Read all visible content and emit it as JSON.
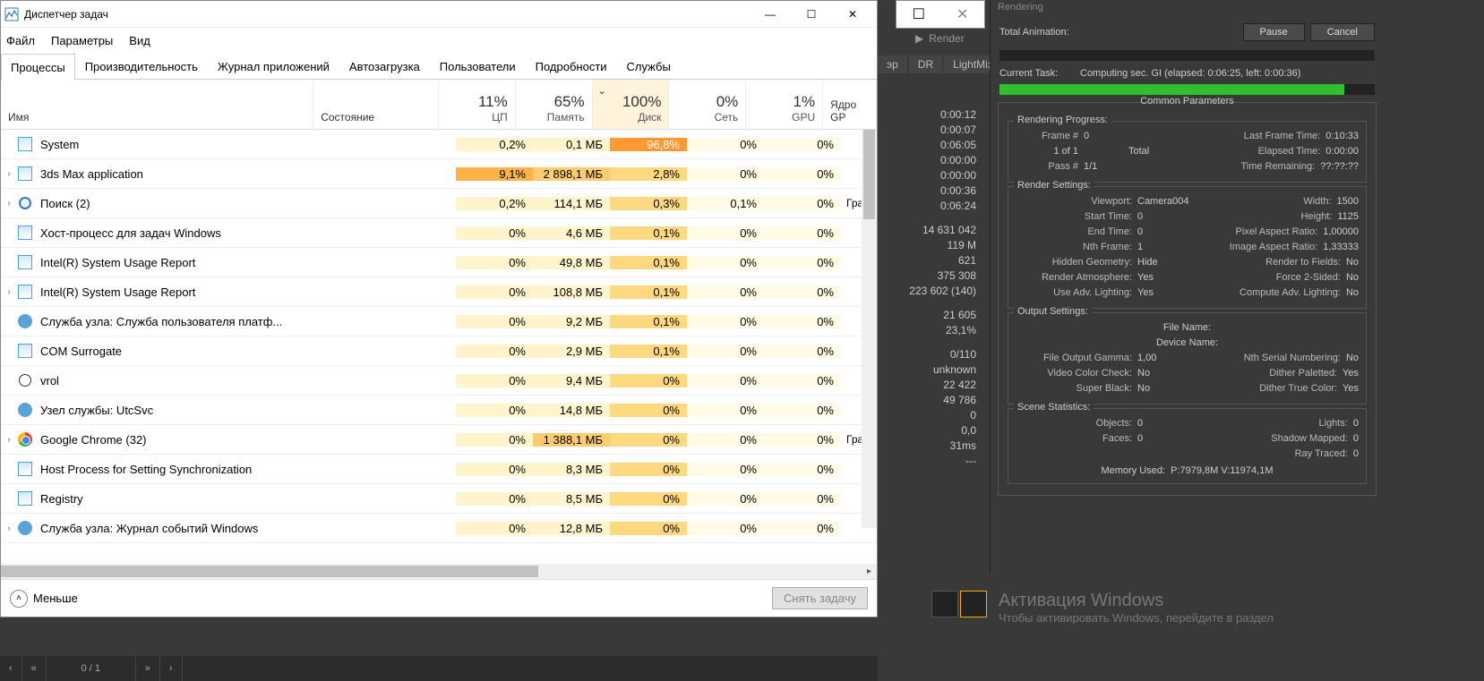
{
  "task_manager": {
    "title": "Диспетчер задач",
    "menu": [
      "Файл",
      "Параметры",
      "Вид"
    ],
    "tabs": [
      "Процессы",
      "Производительность",
      "Журнал приложений",
      "Автозагрузка",
      "Пользователи",
      "Подробности",
      "Службы"
    ],
    "active_tab": 0,
    "headers": {
      "name": "Имя",
      "status": "Состояние",
      "cpu_pct": "11%",
      "cpu_lbl": "ЦП",
      "mem_pct": "65%",
      "mem_lbl": "Память",
      "disk_pct": "100%",
      "disk_lbl": "Диск",
      "net_pct": "0%",
      "net_lbl": "Сеть",
      "gpu_pct": "1%",
      "gpu_lbl": "GPU",
      "gpucore_lbl": "Ядро GP"
    },
    "rows": [
      {
        "exp": "",
        "icon": "app",
        "name": "System",
        "cpu": "0,2%",
        "mem": "0,1 МБ",
        "disk": "96,8%",
        "net": "0%",
        "gpu": "0%",
        "gputxt": "",
        "disk_heat": "heat-vhot"
      },
      {
        "exp": "›",
        "icon": "app",
        "name": "3ds Max application",
        "cpu": "9,1%",
        "mem": "2 898,1 МБ",
        "disk": "2,8%",
        "net": "0%",
        "gpu": "0%",
        "gputxt": "",
        "cpu_heat": "heat-hot",
        "mem_heat": "heat-darker"
      },
      {
        "exp": "›",
        "icon": "search",
        "name": "Поиск (2)",
        "cpu": "0,2%",
        "mem": "114,1 МБ",
        "disk": "0,3%",
        "net": "0,1%",
        "gpu": "0%",
        "gputxt": "Граф"
      },
      {
        "exp": "",
        "icon": "app",
        "name": "Хост-процесс для задач Windows",
        "cpu": "0%",
        "mem": "4,6 МБ",
        "disk": "0,1%",
        "net": "0%",
        "gpu": "0%",
        "gputxt": ""
      },
      {
        "exp": "",
        "icon": "app",
        "name": "Intel(R) System Usage Report",
        "cpu": "0%",
        "mem": "49,8 МБ",
        "disk": "0,1%",
        "net": "0%",
        "gpu": "0%",
        "gputxt": ""
      },
      {
        "exp": "›",
        "icon": "app",
        "name": "Intel(R) System Usage Report",
        "cpu": "0%",
        "mem": "108,8 МБ",
        "disk": "0,1%",
        "net": "0%",
        "gpu": "0%",
        "gputxt": ""
      },
      {
        "exp": "",
        "icon": "gear",
        "name": "Служба узла: Служба пользователя платф...",
        "cpu": "0%",
        "mem": "9,2 МБ",
        "disk": "0,1%",
        "net": "0%",
        "gpu": "0%",
        "gputxt": ""
      },
      {
        "exp": "",
        "icon": "app",
        "name": "COM Surrogate",
        "cpu": "0%",
        "mem": "2,9 МБ",
        "disk": "0,1%",
        "net": "0%",
        "gpu": "0%",
        "gputxt": ""
      },
      {
        "exp": "",
        "icon": "bulb",
        "name": "vrol",
        "cpu": "0%",
        "mem": "9,4 МБ",
        "disk": "0%",
        "net": "0%",
        "gpu": "0%",
        "gputxt": ""
      },
      {
        "exp": "",
        "icon": "gear",
        "name": "Узел службы: UtcSvc",
        "cpu": "0%",
        "mem": "14,8 МБ",
        "disk": "0%",
        "net": "0%",
        "gpu": "0%",
        "gputxt": ""
      },
      {
        "exp": "›",
        "icon": "chrome",
        "name": "Google Chrome (32)",
        "cpu": "0%",
        "mem": "1 388,1 МБ",
        "disk": "0%",
        "net": "0%",
        "gpu": "0%",
        "gputxt": "Граф",
        "mem_heat": "heat-darker"
      },
      {
        "exp": "",
        "icon": "app",
        "name": "Host Process for Setting Synchronization",
        "cpu": "0%",
        "mem": "8,3 МБ",
        "disk": "0%",
        "net": "0%",
        "gpu": "0%",
        "gputxt": ""
      },
      {
        "exp": "",
        "icon": "app",
        "name": "Registry",
        "cpu": "0%",
        "mem": "8,5 МБ",
        "disk": "0%",
        "net": "0%",
        "gpu": "0%",
        "gputxt": ""
      },
      {
        "exp": "›",
        "icon": "gear",
        "name": "Служба узла: Журнал событий Windows",
        "cpu": "0%",
        "mem": "12,8 МБ",
        "disk": "0%",
        "net": "0%",
        "gpu": "0%",
        "gputxt": ""
      }
    ],
    "footer": {
      "less": "Меньше",
      "end_task": "Снять задачу"
    }
  },
  "bg_tabs": [
    "эр",
    "DR",
    "LightMix"
  ],
  "bg_render_label": "Render",
  "stats": {
    "times": [
      "0:00:12",
      "0:00:07",
      "0:06:05",
      "0:00:00",
      "0:00:00",
      "0:00:36",
      "0:06:24"
    ],
    "g1": [
      "14 631 042",
      "119 М",
      "621",
      "375 308",
      "223 602 (140)"
    ],
    "g2": [
      "21 605",
      "23,1%"
    ],
    "g3": [
      "0/110",
      "unknown",
      "22 422",
      "49 786",
      "0",
      "0,0",
      "31ms",
      "---"
    ]
  },
  "render": {
    "title": "Rendering",
    "total_anim": "Total Animation:",
    "pause": "Pause",
    "cancel": "Cancel",
    "cur_task_lbl": "Current Task:",
    "cur_task_val": "Computing sec. GI (elapsed: 0:06:25, left: 0:00:36)",
    "progress_pct": 92,
    "common_params": "Common Parameters",
    "rendering_progress": "Rendering Progress:",
    "frame_num_lbl": "Frame #",
    "frame_num": "0",
    "last_frame_lbl": "Last Frame Time:",
    "last_frame": "0:10:33",
    "of": "1  of  1",
    "total": "Total",
    "elapsed_lbl": "Elapsed Time:",
    "elapsed": "0:00:00",
    "pass_lbl": "Pass #",
    "pass": "1/1",
    "remaining_lbl": "Time Remaining:",
    "remaining": "??:??:??",
    "render_settings": "Render Settings:",
    "rs": [
      {
        "l1": "Viewport:",
        "v1": "Camera004",
        "l2": "Width:",
        "v2": "1500"
      },
      {
        "l1": "Start Time:",
        "v1": "0",
        "l2": "Height:",
        "v2": "1125"
      },
      {
        "l1": "End Time:",
        "v1": "0",
        "l2": "Pixel Aspect Ratio:",
        "v2": "1,00000"
      },
      {
        "l1": "Nth Frame:",
        "v1": "1",
        "l2": "Image Aspect Ratio:",
        "v2": "1,33333"
      },
      {
        "l1": "Hidden Geometry:",
        "v1": "Hide",
        "l2": "Render to Fields:",
        "v2": "No"
      },
      {
        "l1": "Render Atmosphere:",
        "v1": "Yes",
        "l2": "Force 2-Sided:",
        "v2": "No"
      },
      {
        "l1": "Use Adv. Lighting:",
        "v1": "Yes",
        "l2": "Compute Adv. Lighting:",
        "v2": "No"
      }
    ],
    "output_settings": "Output Settings:",
    "file_name": "File Name:",
    "device_name": "Device Name:",
    "os": [
      {
        "l1": "File Output Gamma:",
        "v1": "1,00",
        "l2": "Nth Serial Numbering:",
        "v2": "No"
      },
      {
        "l1": "Video Color Check:",
        "v1": "No",
        "l2": "Dither Paletted:",
        "v2": "Yes"
      },
      {
        "l1": "Super Black:",
        "v1": "No",
        "l2": "Dither True Color:",
        "v2": "Yes"
      }
    ],
    "scene_stats": "Scene Statistics:",
    "ss": [
      {
        "l1": "Objects:",
        "v1": "0",
        "l2": "Lights:",
        "v2": "0"
      },
      {
        "l1": "Faces:",
        "v1": "0",
        "l2": "Shadow Mapped:",
        "v2": "0"
      },
      {
        "l1": "",
        "v1": "",
        "l2": "Ray Traced:",
        "v2": "0"
      }
    ],
    "mem_used_lbl": "Memory Used:",
    "mem_used": "P:7979,8M V:11974,1M"
  },
  "activate": {
    "t1": "Активация Windows",
    "t2": "Чтобы активировать Windows, перейдите в раздел"
  },
  "timeline": {
    "frame": "0 / 1"
  }
}
